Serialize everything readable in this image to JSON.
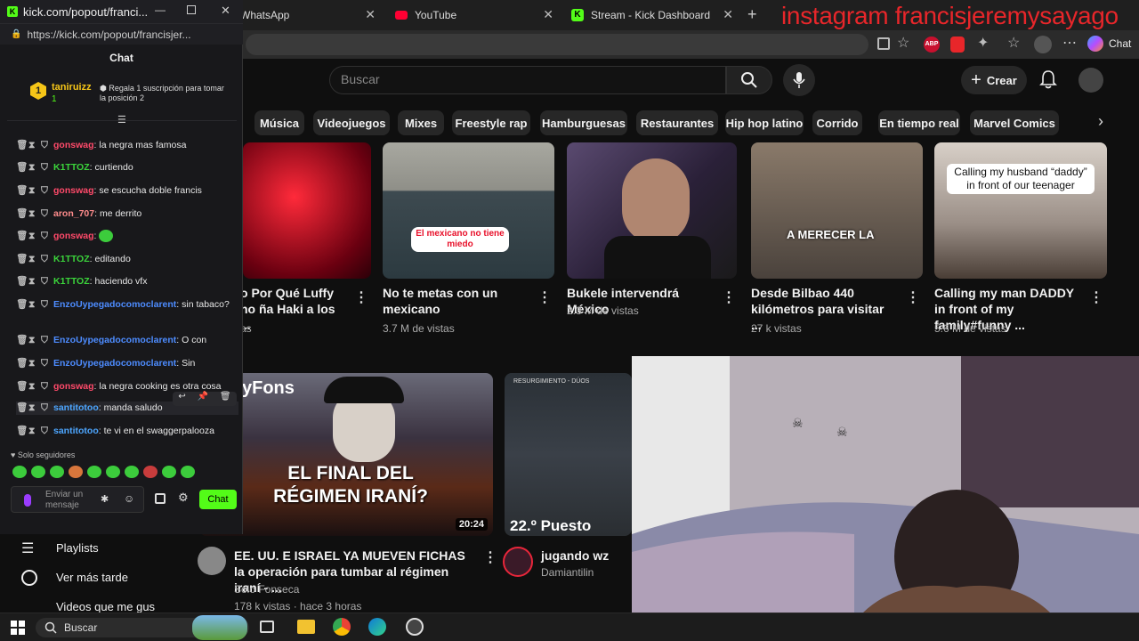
{
  "browser": {
    "tabs": [
      {
        "label": "WhatsApp",
        "favicon": "whatsapp-icon"
      },
      {
        "label": "YouTube",
        "favicon": "youtube-icon"
      },
      {
        "label": "Stream - Kick Dashboard",
        "favicon": "kick-icon"
      }
    ],
    "new_tab": "+",
    "toolbar_chat": "Chat",
    "overlay_text": "instagram francisjeremysayago"
  },
  "kick": {
    "window_title": "kick.com/popout/franci...",
    "url": "https://kick.com/popout/francisjer...",
    "header": "Chat",
    "pinned": {
      "user": "taniruizz",
      "count": "1",
      "cta": "Regala 1 suscripción para tomar la posición 2"
    },
    "messages": [
      {
        "user": "gonswag",
        "color": "#ff4a6a",
        "text": "la negra mas famosa"
      },
      {
        "user": "K1TTOZ",
        "color": "#3bd43b",
        "text": "curtiendo"
      },
      {
        "user": "gonswag",
        "color": "#ff4a6a",
        "text": "se escucha doble francis"
      },
      {
        "user": "aron_707",
        "color": "#ff8c8c",
        "text": "me derrito"
      },
      {
        "user": "gonswag",
        "color": "#ff4a6a",
        "text": ""
      },
      {
        "user": "K1TTOZ",
        "color": "#3bd43b",
        "text": "editando"
      },
      {
        "user": "K1TTOZ",
        "color": "#3bd43b",
        "text": "haciendo vfx"
      },
      {
        "user": "EnzoUypegadocomoclarent",
        "color": "#4d8cff",
        "text": "sin tabaco?"
      },
      {
        "user": "EnzoUypegadocomoclarent",
        "color": "#4d8cff",
        "text": "O con"
      },
      {
        "user": "EnzoUypegadocomoclarent",
        "color": "#4d8cff",
        "text": "Sin"
      },
      {
        "user": "gonswag",
        "color": "#ff4a6a",
        "text": "la negra cooking es otra cosa"
      },
      {
        "user": "santitotoo",
        "color": "#4da6ff",
        "text": "manda saludo"
      },
      {
        "user": "santitotoo",
        "color": "#4da6ff",
        "text": "te vi en el swaggerpalooza"
      }
    ],
    "followers_only": "Solo seguidores",
    "input_placeholder": "Enviar un mensaje",
    "send_label": "Chat"
  },
  "youtube": {
    "search_placeholder": "Buscar",
    "create_label": "Crear",
    "chips": [
      "Música",
      "Videojuegos",
      "Mixes",
      "Freestyle rap",
      "Hamburguesas",
      "Restaurantes",
      "Hip hop latino",
      "Corrido",
      "En tiempo real",
      "Marvel Comics"
    ],
    "videos_row1": [
      {
        "title": "o Por Qué Luffy no ña Haki a los ...",
        "meta": "as"
      },
      {
        "title": "No te metas con un mexicano",
        "meta": "3.7 M de vistas",
        "thumb_text": "El mexicano no tiene miedo"
      },
      {
        "title": "Bukele intervendrá México",
        "meta": "2.3 M de vistas"
      },
      {
        "title": "Desde Bilbao 440 kilómetros para visitar ...",
        "meta": "27 k vistas",
        "thumb_text": "A MERECER LA"
      },
      {
        "title": "Calling my man DADDY in front of my family#funny ...",
        "meta": "5.6 M de vistas",
        "thumb_text": "Calling my husband “daddy” in front of our teenager"
      }
    ],
    "videos_row2": [
      {
        "title": "EE. UU. E ISRAEL YA MUEVEN FICHAS la operación para tumbar al régimen iraní - ...",
        "channel": "Solo Fonseca",
        "meta": "178 k vistas · hace 3 horas",
        "duration": "20:24",
        "thumb_text": "EL FINAL DEL RÉGIMEN IRANÍ?",
        "thumb_brand": "yFons"
      },
      {
        "title": "jugando wz",
        "channel": "Damiantilin",
        "thumb_text": "22.º Puesto",
        "thumb_top": "RESURGIMIENTO - DÚOS"
      }
    ],
    "sidebar": [
      "Playlists",
      "Ver más tarde",
      "Videos que me gus"
    ]
  },
  "taskbar": {
    "search": "Buscar"
  }
}
